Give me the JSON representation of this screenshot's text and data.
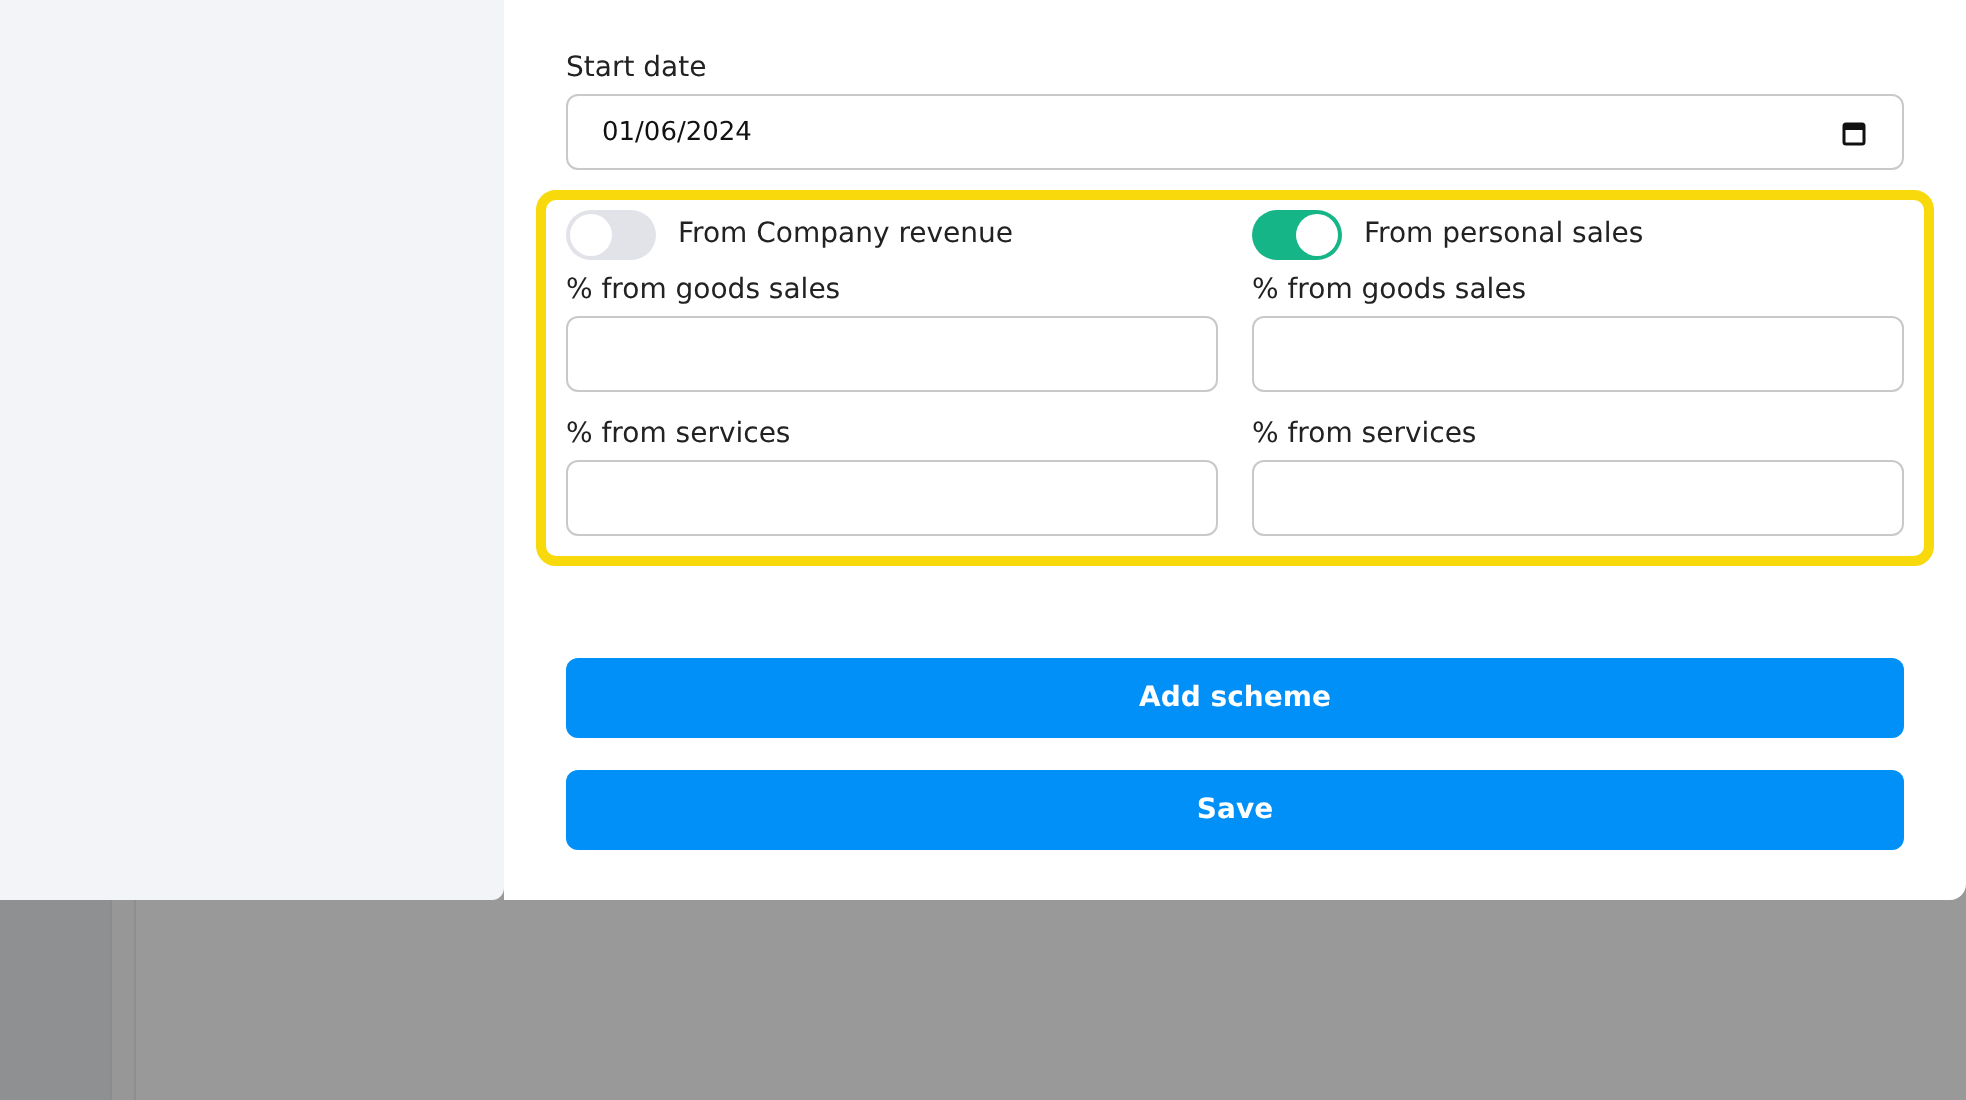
{
  "start_date": {
    "label": "Start date",
    "value": "01/06/2024"
  },
  "highlighted": true,
  "schemes": [
    {
      "title": "From Company revenue",
      "on": false,
      "fields": [
        {
          "label": "% from goods sales"
        },
        {
          "label": "% from services"
        }
      ]
    },
    {
      "title": "From personal sales",
      "on": true,
      "fields": [
        {
          "label": "% from goods sales"
        },
        {
          "label": "% from services"
        }
      ]
    }
  ],
  "buttons": [
    {
      "label": "Add scheme"
    },
    {
      "label": "Save"
    }
  ]
}
